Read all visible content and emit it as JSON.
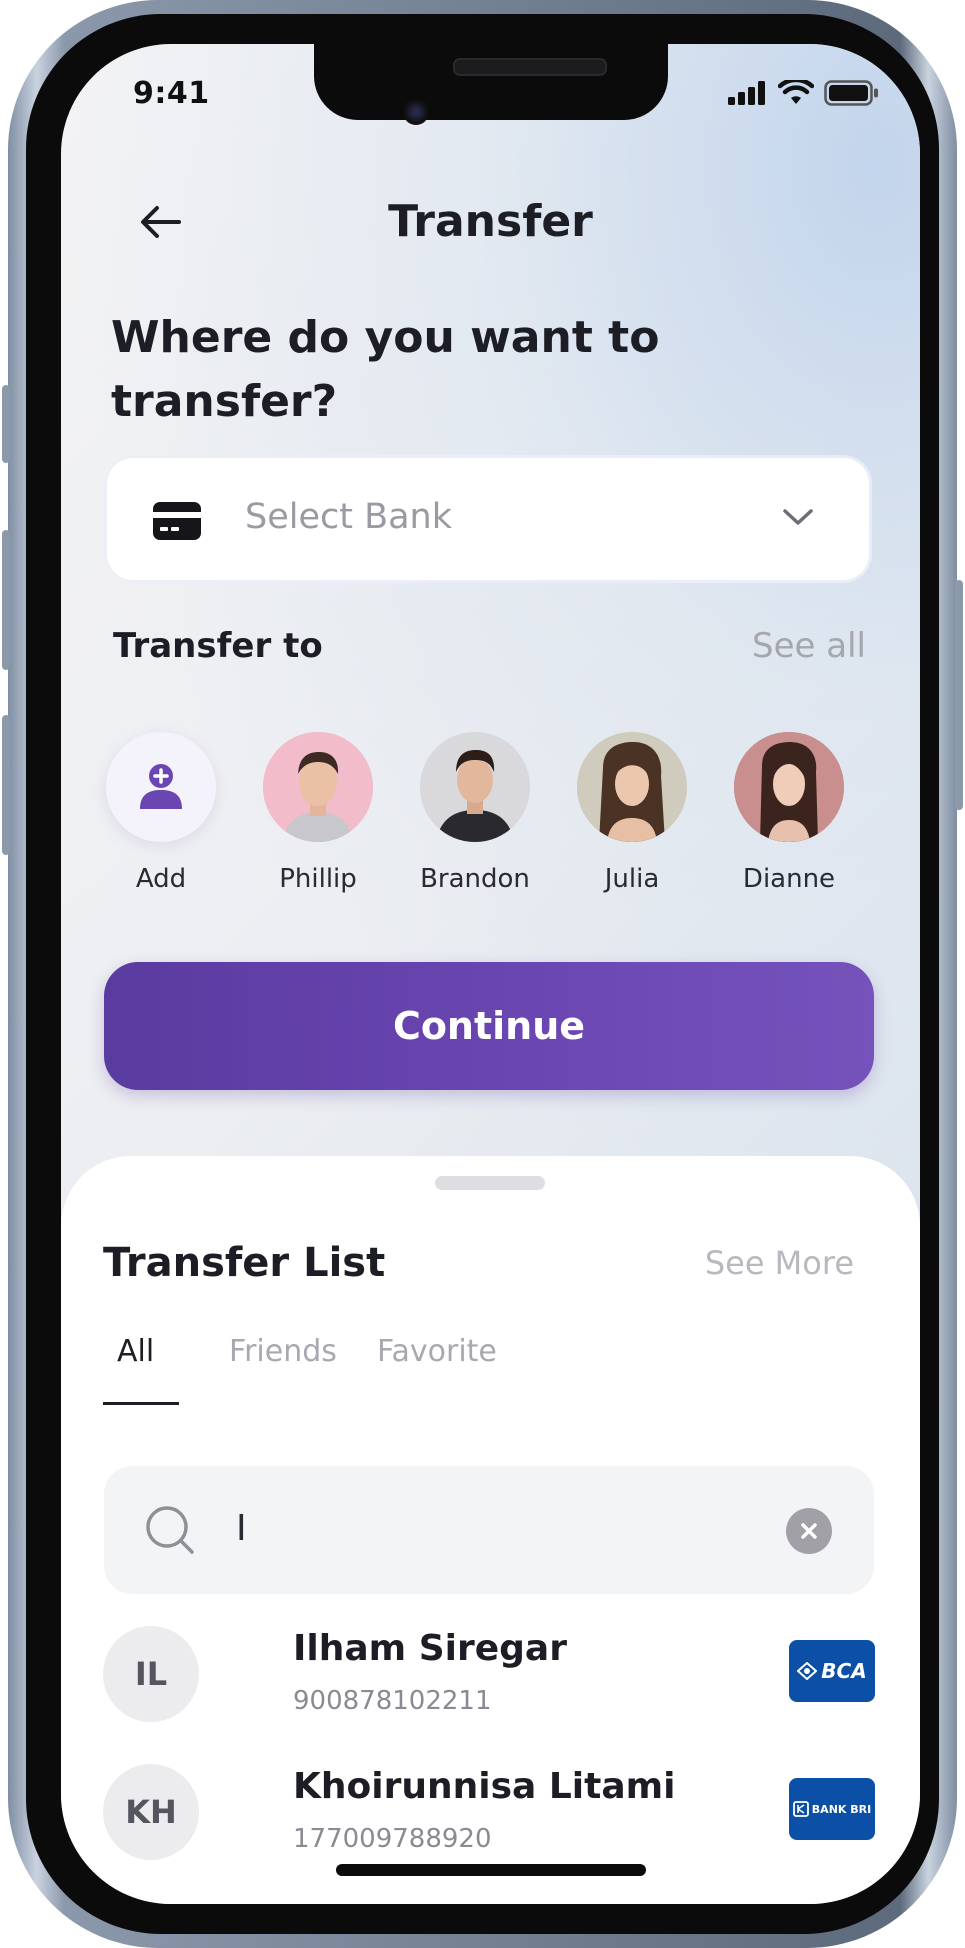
{
  "status_bar": {
    "time": "9:41"
  },
  "header": {
    "title": "Transfer"
  },
  "question": "Where do you want to transfer?",
  "bank_select": {
    "placeholder": "Select Bank"
  },
  "transfer_to": {
    "label": "Transfer to",
    "see_all": "See all",
    "contacts": [
      {
        "name": "Add"
      },
      {
        "name": "Phillip"
      },
      {
        "name": "Brandon"
      },
      {
        "name": "Julia"
      },
      {
        "name": "Dianne"
      }
    ]
  },
  "continue_label": "Continue",
  "transfer_list": {
    "title": "Transfer List",
    "see_more": "See More",
    "tabs": [
      {
        "label": "All",
        "active": true
      },
      {
        "label": "Friends",
        "active": false
      },
      {
        "label": "Favorite",
        "active": false
      }
    ],
    "search_value": "I",
    "items": [
      {
        "initials": "IL",
        "name": "Ilham Siregar",
        "account": "900878102211",
        "bank": "BCA"
      },
      {
        "initials": "KH",
        "name": "Khoirunnisa Litami",
        "account": "177009788920",
        "bank": "BANK BRI"
      }
    ]
  },
  "colors": {
    "primary": "#6a46b2",
    "text_dark": "#1d1d26",
    "muted": "#a6a6ae",
    "bank_blue": "#0b4fa6"
  }
}
